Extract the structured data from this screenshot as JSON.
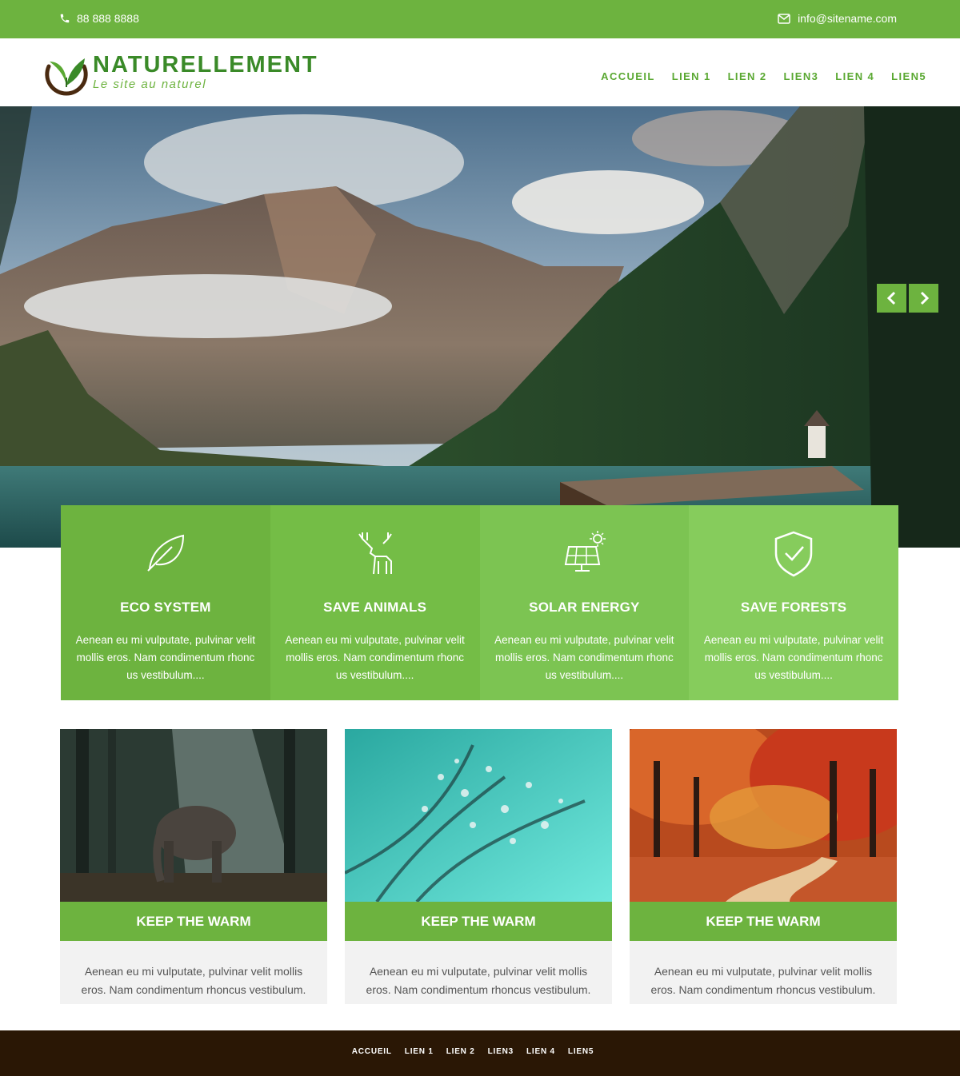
{
  "topbar": {
    "phone": "88 888 8888",
    "email": "info@sitename.com",
    "phone_icon": "phone-icon",
    "email_icon": "envelope-icon"
  },
  "brand": {
    "name": "NATURELLEMENT",
    "tagline": "Le site au naturel",
    "logo_icon": "leaf-logo-icon"
  },
  "nav": {
    "items": [
      "ACCUEIL",
      "LIEN 1",
      "LIEN 2",
      "LIEN3",
      "LIEN 4",
      "LIEN5"
    ]
  },
  "hero": {
    "prev_icon": "chevron-left-icon",
    "next_icon": "chevron-right-icon"
  },
  "features": [
    {
      "icon": "leaf-icon",
      "title": "ECO SYSTEM",
      "text": "Aenean eu mi vulputate, pulvinar velit mollis eros. Nam condimentum rhonc us vestibulum...."
    },
    {
      "icon": "deer-icon",
      "title": "SAVE ANIMALS",
      "text": "Aenean eu mi vulputate, pulvinar velit mollis eros. Nam condimentum rhonc us vestibulum...."
    },
    {
      "icon": "solar-panel-icon",
      "title": "SOLAR ENERGY",
      "text": "Aenean eu mi vulputate, pulvinar velit mollis eros. Nam condimentum rhonc us vestibulum...."
    },
    {
      "icon": "shield-check-icon",
      "title": "SAVE FORESTS",
      "text": "Aenean eu mi vulputate, pulvinar velit mollis eros. Nam condimentum rhonc us vestibulum...."
    }
  ],
  "cards": [
    {
      "title": "KEEP THE WARM",
      "text": "Aenean eu mi vulputate, pulvinar velit mollis eros. Nam condimentum rhoncus vestibulum."
    },
    {
      "title": "KEEP THE WARM",
      "text": "Aenean eu mi vulputate, pulvinar velit mollis eros. Nam condimentum rhoncus vestibulum."
    },
    {
      "title": "KEEP THE WARM",
      "text": "Aenean eu mi vulputate, pulvinar velit mollis eros. Nam condimentum rhoncus vestibulum."
    }
  ],
  "footer": {
    "items": [
      "ACCUEIL",
      "LIEN 1",
      "LIEN 2",
      "LIEN3",
      "LIEN 4",
      "LIEN5"
    ]
  },
  "colors": {
    "primary_green": "#6db33f",
    "feature_1": "#6db33f",
    "feature_2": "#74bd46",
    "feature_3": "#7cc452",
    "feature_4": "#86cc5c",
    "footer_brown": "#2a1705",
    "card_body": "#f2f2f2"
  }
}
